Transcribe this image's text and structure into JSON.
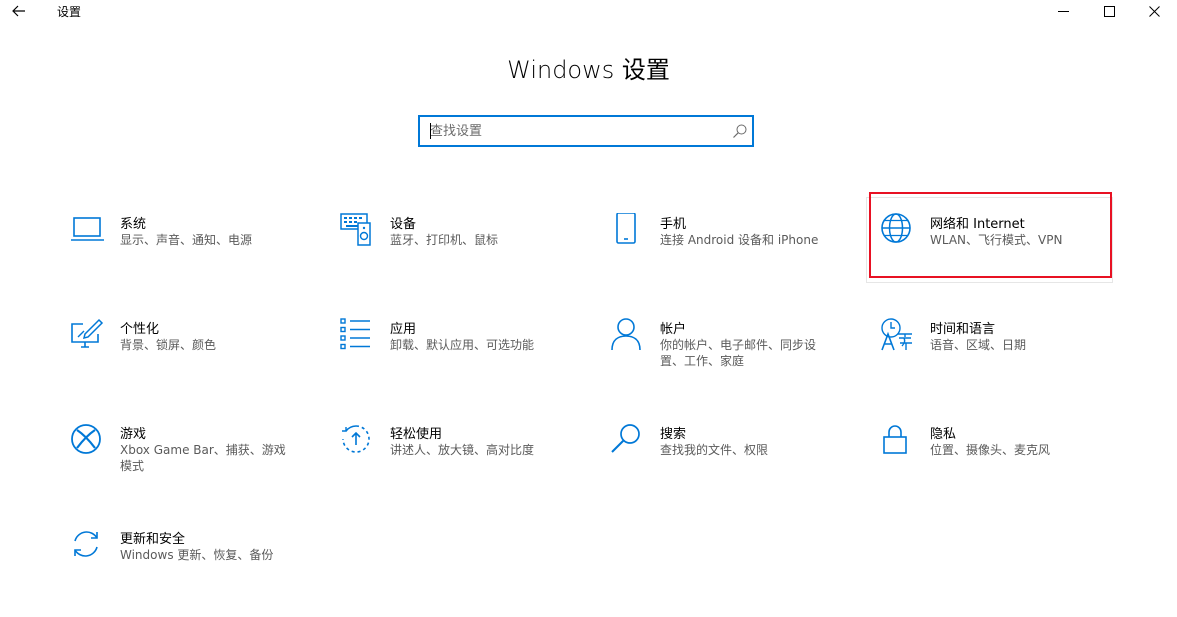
{
  "window": {
    "app_title": "设置",
    "back_icon": "back-arrow-icon",
    "minimize_icon": "minimize-icon",
    "maximize_icon": "maximize-icon",
    "close_icon": "close-icon"
  },
  "page": {
    "title": "Windows 设置"
  },
  "search": {
    "placeholder": "查找设置",
    "value": "",
    "icon": "search-icon"
  },
  "accent_color": "#0078d7",
  "highlight_color": "#e81123",
  "tiles": [
    {
      "id": "system",
      "label": "系统",
      "desc": "显示、声音、通知、电源",
      "icon": "laptop-icon"
    },
    {
      "id": "devices",
      "label": "设备",
      "desc": "蓝牙、打印机、鼠标",
      "icon": "keyboard-speaker-icon"
    },
    {
      "id": "phone",
      "label": "手机",
      "desc": "连接 Android 设备和 iPhone",
      "icon": "phone-icon"
    },
    {
      "id": "network",
      "label": "网络和 Internet",
      "desc": "WLAN、飞行模式、VPN",
      "icon": "globe-icon",
      "highlighted": true
    },
    {
      "id": "personalization",
      "label": "个性化",
      "desc": "背景、锁屏、颜色",
      "icon": "paint-brush-monitor-icon"
    },
    {
      "id": "apps",
      "label": "应用",
      "desc": "卸载、默认应用、可选功能",
      "icon": "app-list-icon"
    },
    {
      "id": "accounts",
      "label": "帐户",
      "desc": "你的帐户、电子邮件、同步设置、工作、家庭",
      "icon": "person-icon"
    },
    {
      "id": "time-language",
      "label": "时间和语言",
      "desc": "语音、区域、日期",
      "icon": "language-icon"
    },
    {
      "id": "gaming",
      "label": "游戏",
      "desc": "Xbox Game Bar、捕获、游戏模式",
      "icon": "xbox-icon"
    },
    {
      "id": "ease-of-access",
      "label": "轻松使用",
      "desc": "讲述人、放大镜、高对比度",
      "icon": "ease-of-access-icon"
    },
    {
      "id": "search",
      "label": "搜索",
      "desc": "查找我的文件、权限",
      "icon": "magnifier-icon"
    },
    {
      "id": "privacy",
      "label": "隐私",
      "desc": "位置、摄像头、麦克风",
      "icon": "lock-icon"
    },
    {
      "id": "update-security",
      "label": "更新和安全",
      "desc": "Windows 更新、恢复、备份",
      "icon": "sync-arrows-icon"
    }
  ]
}
